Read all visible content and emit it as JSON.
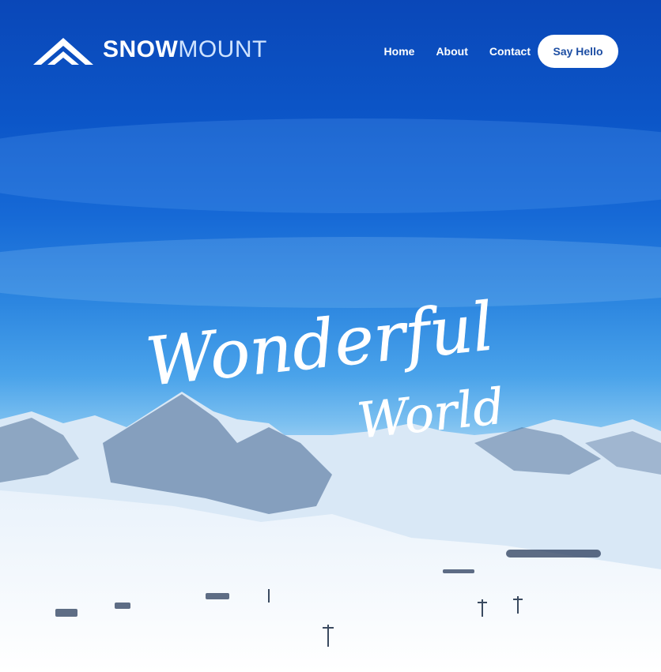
{
  "brand": {
    "name_bold": "SNOW",
    "name_light": "MOUNT",
    "icon": "mountain-chevrons-icon"
  },
  "nav": {
    "items": [
      {
        "label": "Home"
      },
      {
        "label": "About"
      },
      {
        "label": "Contact"
      }
    ],
    "cta_label": "Say Hello"
  },
  "hero": {
    "line1": "Wonderful",
    "line2": "World"
  },
  "colors": {
    "sky_top": "#0a47b8",
    "sky_mid": "#2c86e0",
    "snow": "#ffffff",
    "cta_text": "#1d4ea3"
  }
}
